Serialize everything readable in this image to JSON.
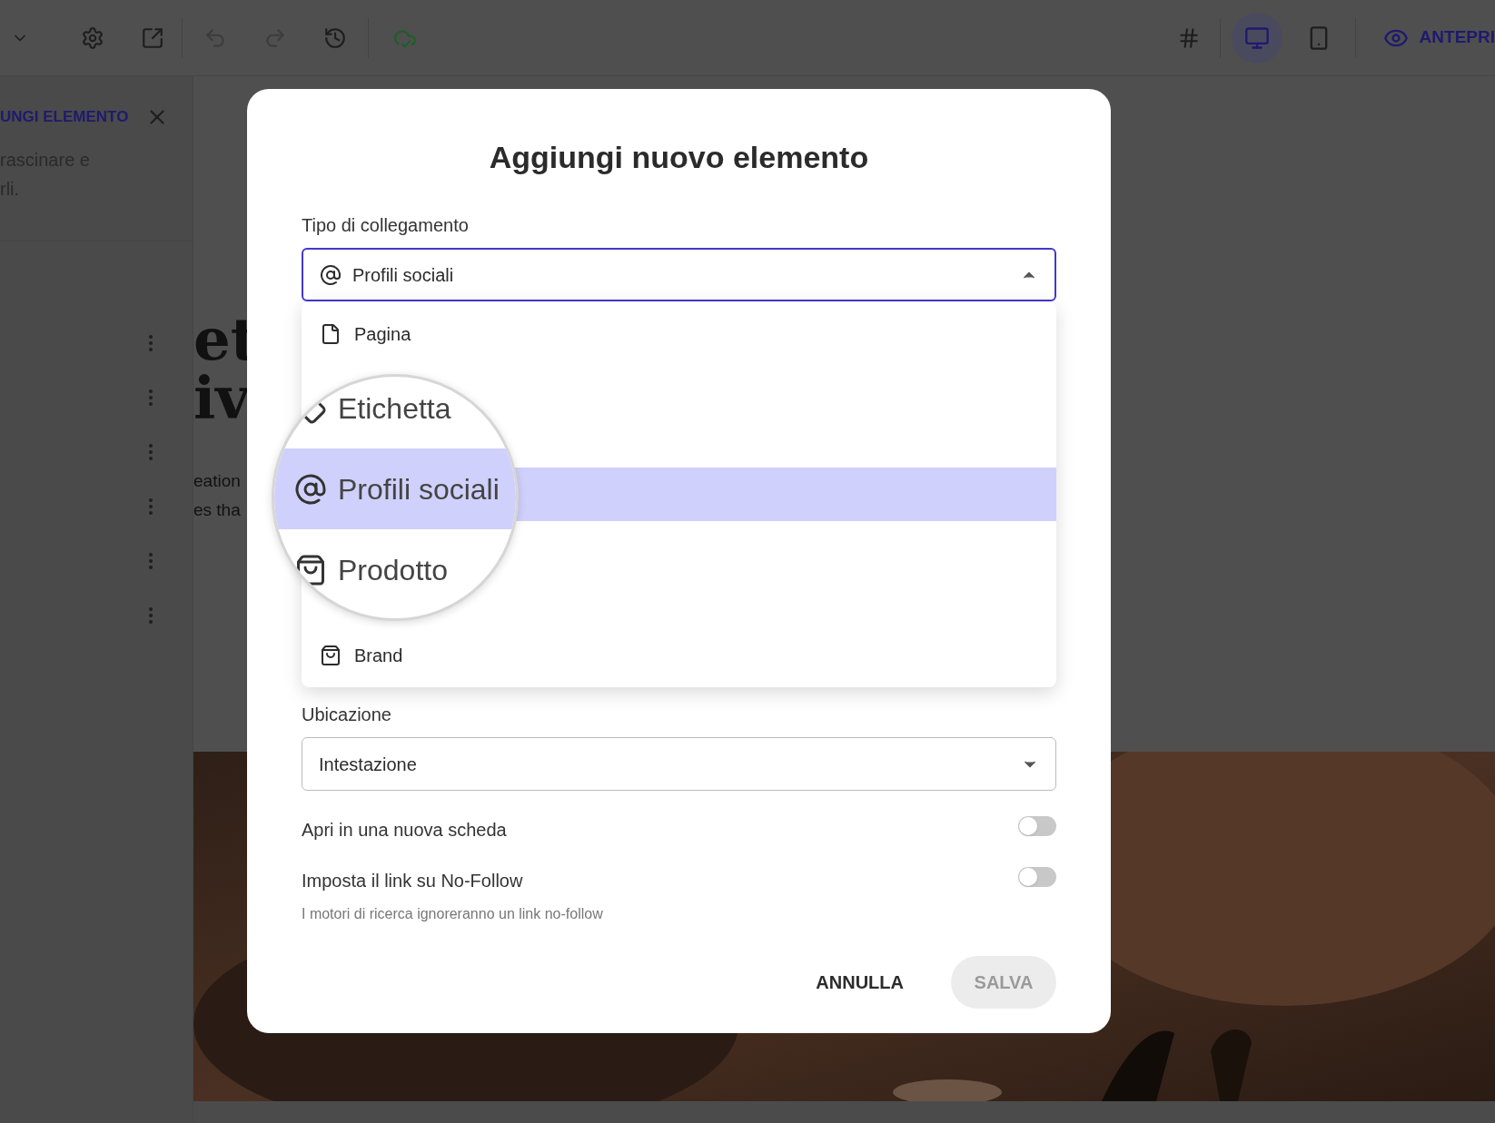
{
  "toolbar": {
    "devices": [
      {
        "kind": "desktop",
        "selected": true
      },
      {
        "kind": "mobile",
        "selected": false
      }
    ],
    "preview_button": "ANTEPRI"
  },
  "sidebar": {
    "title": "UNGI ELEMENTO",
    "description_lines": [
      "rascinare e",
      "rli."
    ]
  },
  "canvas": {
    "heading_lines": [
      "et",
      "iv"
    ],
    "text_lines": [
      "eation",
      "es tha"
    ]
  },
  "dialog": {
    "title": "Aggiungi nuovo elemento",
    "link_type": {
      "label": "Tipo di collegamento",
      "value": "Profili sociali",
      "expanded": true
    },
    "options": [
      {
        "label": "Pagina",
        "kind": "page"
      },
      {
        "label": "Brand",
        "kind": "bag"
      }
    ],
    "magnifier": {
      "items": [
        {
          "label": "Etichetta",
          "kind": "tag",
          "selected": false
        },
        {
          "label": "Profili sociali",
          "kind": "at",
          "selected": true
        },
        {
          "label": "Prodotto",
          "kind": "bag",
          "selected": false
        }
      ]
    },
    "location": {
      "label": "Ubicazione",
      "value": "Intestazione"
    },
    "toggles": [
      {
        "label": "Apri in una nuova scheda",
        "on": false
      },
      {
        "label": "Imposta il link su No-Follow",
        "on": false,
        "hint": "I motori di ricerca ignoreranno un link no-follow"
      }
    ],
    "buttons": {
      "cancel": "ANNULLA",
      "save": "SALVA",
      "save_disabled": true
    }
  }
}
